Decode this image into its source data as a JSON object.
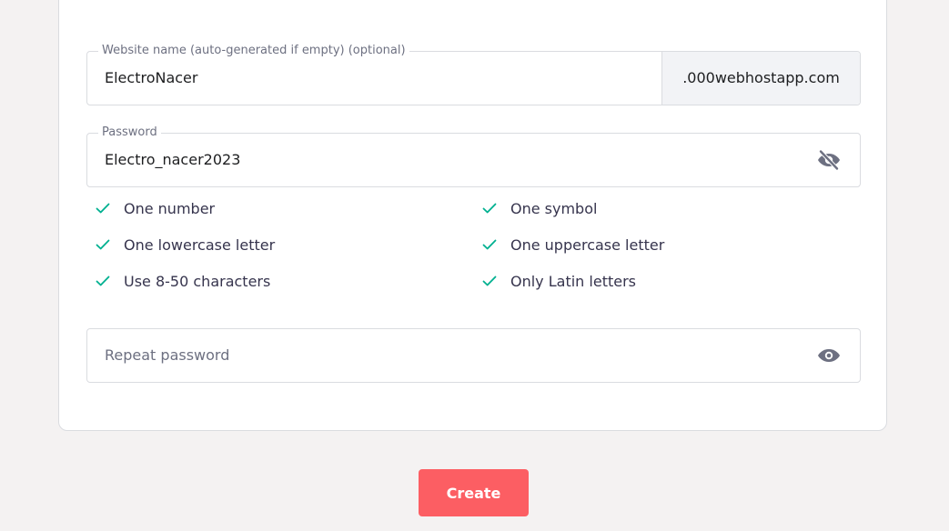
{
  "website": {
    "label": "Website name (auto-generated if empty) (optional)",
    "value": "ElectroNacer",
    "suffix": ".000webhostapp.com"
  },
  "password": {
    "label": "Password",
    "value": "Electro_nacer2023",
    "toggle_icon": "eye-slash-icon"
  },
  "rules": [
    {
      "text": "One number",
      "met": true
    },
    {
      "text": "One symbol",
      "met": true
    },
    {
      "text": "One lowercase letter",
      "met": true
    },
    {
      "text": "One uppercase letter",
      "met": true
    },
    {
      "text": "Use 8-50 characters",
      "met": true
    },
    {
      "text": "Only Latin letters",
      "met": true
    }
  ],
  "repeat_password": {
    "placeholder": "Repeat password",
    "value": "",
    "toggle_icon": "eye-icon"
  },
  "create_button": {
    "label": "Create"
  },
  "colors": {
    "accent": "#fc5e63",
    "check": "#00b090",
    "icon": "#6d7081"
  }
}
